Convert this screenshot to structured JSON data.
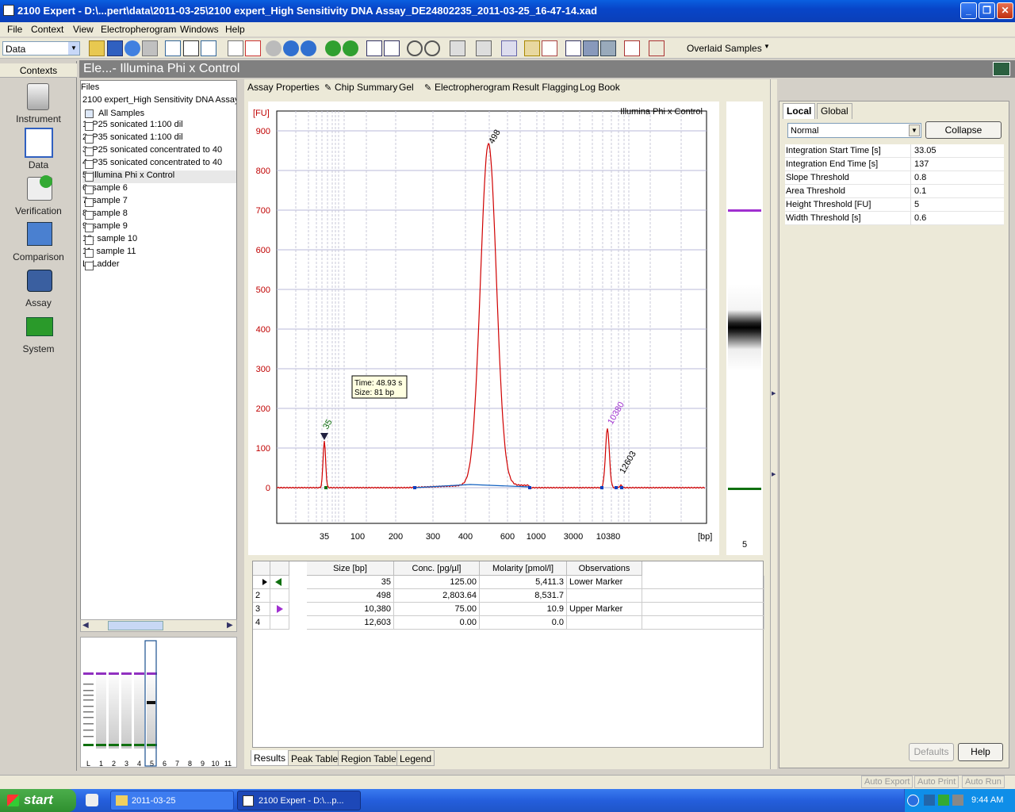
{
  "window": {
    "title": "2100 Expert - D:\\...pert\\data\\2011-03-25\\2100 expert_High Sensitivity DNA Assay_DE24802235_2011-03-25_16-47-14.xad"
  },
  "menu": [
    "File",
    "Context",
    "View",
    "Electropherogram",
    "Windows",
    "Help"
  ],
  "toolbar": {
    "context_select": "Data",
    "overlay_select": "Overlaid Samples"
  },
  "contexts": {
    "title": "Contexts",
    "items": [
      "Instrument",
      "Data",
      "Verification",
      "Comparison",
      "Assay",
      "System"
    ]
  },
  "header": {
    "title": "Ele...- Illumina Phi x Control"
  },
  "tree": {
    "heading": "Files",
    "file": "2100 expert_High Sensitivity DNA Assay",
    "all": "All Samples",
    "samples": [
      "1: P25 sonicated 1:100 dil",
      "2: P35 sonicated 1:100 dil",
      "3: P25 sonicated concentrated to 40",
      "4: P35 sonicated concentrated to 40",
      "5: Illumina Phi x Control",
      "6: sample 6",
      "7: sample 7",
      "8: sample 8",
      "9: sample 9",
      "10: sample 10",
      "11: sample 11",
      "L: Ladder"
    ]
  },
  "minigel": {
    "lanes": [
      "L",
      "1",
      "2",
      "3",
      "4",
      "5",
      "6",
      "7",
      "8",
      "9",
      "10",
      "11"
    ]
  },
  "tabs": [
    "Assay Properties",
    "Chip Summary",
    "Gel",
    "Electropherogram",
    "Result Flagging",
    "Log Book"
  ],
  "chart_data": {
    "type": "line",
    "title": "Illumina Phi x Control",
    "ylabel": "[FU]",
    "xlabel": "[bp]",
    "ylim": [
      -90,
      950
    ],
    "y_ticks": [
      0,
      100,
      200,
      300,
      400,
      500,
      600,
      700,
      800,
      900
    ],
    "x_tick_labels": [
      "35",
      "100",
      "200",
      "300",
      "400",
      "600",
      "1000",
      "3000",
      "10380"
    ],
    "series": [
      {
        "x": [
          "35",
          "498",
          "10380",
          "12603"
        ],
        "y": [
          118,
          862,
          150,
          6
        ]
      }
    ],
    "peak_labels": [
      "35",
      "498",
      "10380",
      "12603"
    ],
    "tooltip": {
      "time": "Time: 48.93 s",
      "size": "Size: 81 bp"
    }
  },
  "gel_lane": {
    "label": "5"
  },
  "peak_table": {
    "columns": [
      "Size [bp]",
      "Conc. [pg/µl]",
      "Molarity [pmol/l]",
      "Observations"
    ],
    "rows": [
      {
        "idx": "",
        "size": "35",
        "conc": "125.00",
        "mol": "5,411.3",
        "obs": "Lower Marker"
      },
      {
        "idx": "2",
        "size": "498",
        "conc": "2,803.64",
        "mol": "8,531.7",
        "obs": ""
      },
      {
        "idx": "3",
        "size": "10,380",
        "conc": "75.00",
        "mol": "10.9",
        "obs": "Upper Marker"
      },
      {
        "idx": "4",
        "size": "12,603",
        "conc": "0.00",
        "mol": "0.0",
        "obs": ""
      }
    ]
  },
  "bottom_tabs": [
    "Results",
    "Peak Table",
    "Region Table",
    "Legend"
  ],
  "right_panel": {
    "tabs": [
      "Local",
      "Global"
    ],
    "mode": "Normal",
    "collapse": "Collapse",
    "props": [
      {
        "k": "Integration Start Time [s]",
        "v": "33.05"
      },
      {
        "k": "Integration End Time [s]",
        "v": "137"
      },
      {
        "k": "Slope Threshold",
        "v": "0.8"
      },
      {
        "k": "Area Threshold",
        "v": "0.1"
      },
      {
        "k": "Height Threshold [FU]",
        "v": "5"
      },
      {
        "k": "Width Threshold [s]",
        "v": "0.6"
      }
    ],
    "defaults": "Defaults",
    "help": "Help"
  },
  "status": {
    "auto_export": "Auto Export",
    "auto_print": "Auto Print",
    "auto_run": "Auto Run"
  },
  "taskbar": {
    "start": "start",
    "tasks": [
      "2011-03-25",
      "2100 Expert - D:\\...p..."
    ],
    "clock": "9:44 AM"
  },
  "colors": {
    "trace": "#d00000",
    "marker_upper": "#a030d0",
    "marker_lower": "#107010",
    "baseline": "#1060c0"
  }
}
